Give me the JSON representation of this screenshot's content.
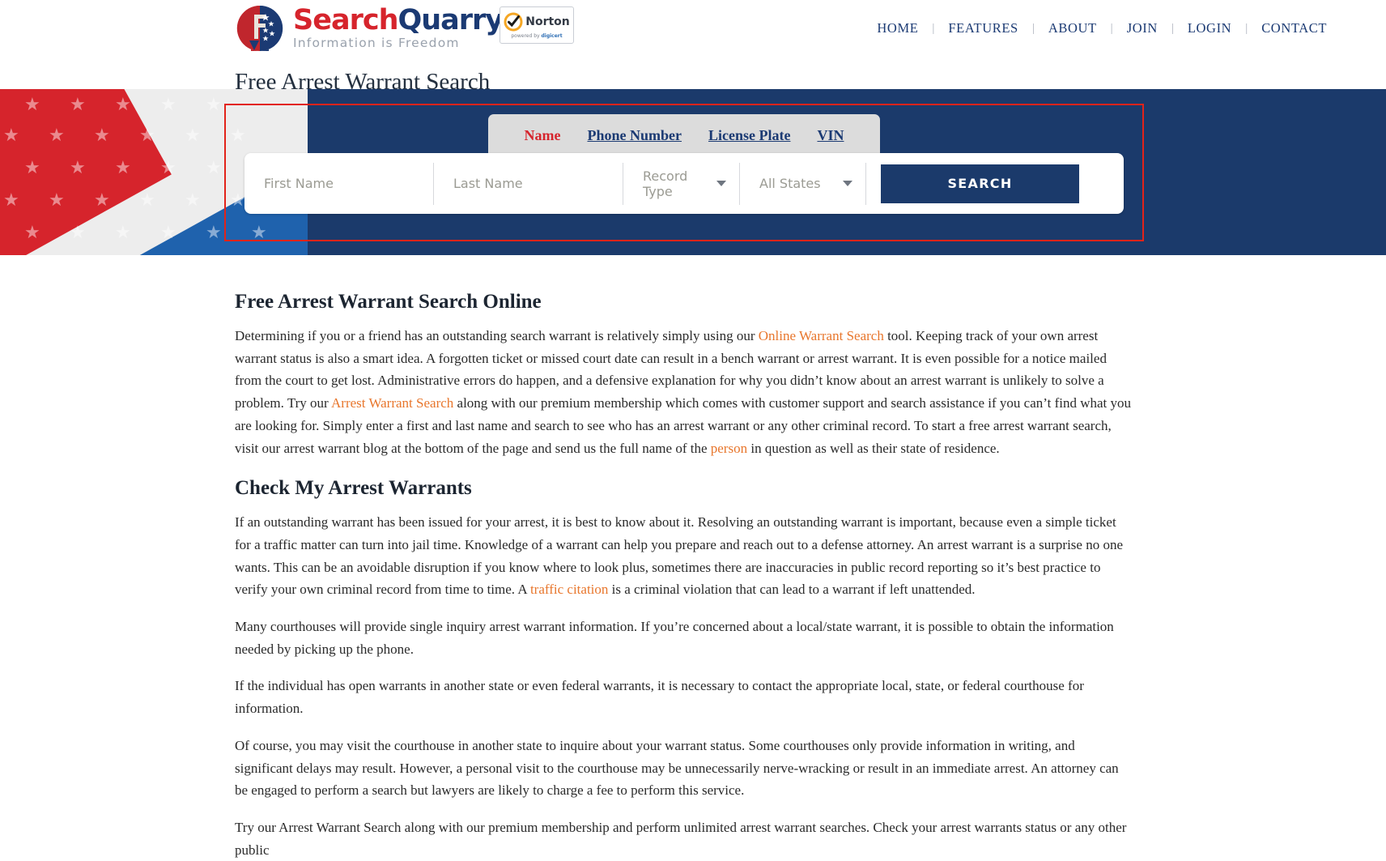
{
  "brand": {
    "name_part1": "Search",
    "name_part2": "Quarry",
    "tagline": "Information is Freedom",
    "logo_icon": "searchquarry-shield-logo"
  },
  "trust_badge": {
    "word": "Norton",
    "powered_by_prefix": "powered by ",
    "powered_by_brand": "digicert",
    "check_icon": "norton-checkmark-icon"
  },
  "nav": {
    "items": [
      {
        "label": "HOME"
      },
      {
        "label": "FEATURES"
      },
      {
        "label": "ABOUT"
      },
      {
        "label": "JOIN"
      },
      {
        "label": "LOGIN"
      },
      {
        "label": "CONTACT"
      }
    ],
    "separator": "|"
  },
  "page_title": "Free Arrest Warrant Search",
  "search_widget": {
    "tabs": [
      {
        "label": "Name",
        "active": true
      },
      {
        "label": "Phone Number",
        "active": false
      },
      {
        "label": "License Plate",
        "active": false
      },
      {
        "label": "VIN",
        "active": false
      }
    ],
    "first_name": {
      "value": "",
      "placeholder": "First Name"
    },
    "last_name": {
      "value": "",
      "placeholder": "Last Name"
    },
    "record_type": {
      "selected": "Record Type"
    },
    "state": {
      "selected": "All States"
    },
    "submit_label": "SEARCH"
  },
  "colors": {
    "navy": "#1b3a6b",
    "red": "#d6242c",
    "accent_link": "#e8762c",
    "highlight_box": "#e2231a",
    "tab_active": "#d6242c",
    "tab_inactive": "#1b3a73"
  },
  "sections": [
    {
      "heading": "Free Arrest Warrant Search Online",
      "paragraphs": [
        {
          "runs": [
            {
              "t": "Determining if you or a friend has an outstanding search warrant is relatively simply using our ",
              "link": false
            },
            {
              "t": "Online Warrant Search",
              "link": true
            },
            {
              "t": " tool. Keeping track of your own arrest warrant status is also a smart idea. A forgotten ticket or missed court date can result in a bench warrant or arrest warrant. It is even possible for a notice mailed from the court to get lost. Administrative errors do happen, and a defensive explanation for why you didn’t know about an arrest warrant is unlikely to solve a problem. Try our ",
              "link": false
            },
            {
              "t": "Arrest Warrant Search",
              "link": true
            },
            {
              "t": " along with our premium membership which comes with customer support and search assistance if you can’t find what you are looking for. Simply enter a first and last name and search to see who has an arrest warrant or any other criminal record. To start a free arrest warrant search, visit our arrest warrant blog at the bottom of the page and send us the full name of the ",
              "link": false
            },
            {
              "t": "person",
              "link": true
            },
            {
              "t": " in question as well as their state of residence.",
              "link": false
            }
          ]
        }
      ]
    },
    {
      "heading": "Check My Arrest Warrants",
      "paragraphs": [
        {
          "runs": [
            {
              "t": "If an outstanding warrant has been issued for your arrest, it is best to know about it. Resolving an outstanding warrant is important, because even a simple ticket for a traffic matter can turn into jail time. Knowledge of a warrant can help you prepare and reach out to a defense attorney. An arrest warrant is a surprise no one wants. This can be an avoidable disruption if you know where to look plus, sometimes there are inaccuracies in public record reporting so it’s best practice to verify your own criminal record from time to time. A ",
              "link": false
            },
            {
              "t": "traffic citation",
              "link": true
            },
            {
              "t": " is a criminal violation that can lead to a warrant if left unattended.",
              "link": false
            }
          ]
        },
        {
          "runs": [
            {
              "t": "Many courthouses will provide single inquiry arrest warrant information. If you’re concerned about a local/state warrant, it is possible to obtain the information needed by picking up the phone.",
              "link": false
            }
          ]
        },
        {
          "runs": [
            {
              "t": "If the individual has open warrants in another state or even federal warrants, it is necessary to contact the appropriate local, state, or federal courthouse for information.",
              "link": false
            }
          ]
        },
        {
          "runs": [
            {
              "t": "Of course, you may visit the courthouse in another state to inquire about your warrant status. Some courthouses only provide information in writing, and significant delays may result. However, a personal visit to the courthouse may be unnecessarily nerve-wracking or result in an immediate arrest. An attorney can be engaged to perform a search but lawyers are likely to charge a fee to perform this service.",
              "link": false
            }
          ]
        },
        {
          "runs": [
            {
              "t": "Try our Arrest Warrant Search along with our premium membership and perform unlimited arrest warrant searches. Check your arrest warrants status or any other public",
              "link": false
            }
          ]
        }
      ]
    }
  ]
}
